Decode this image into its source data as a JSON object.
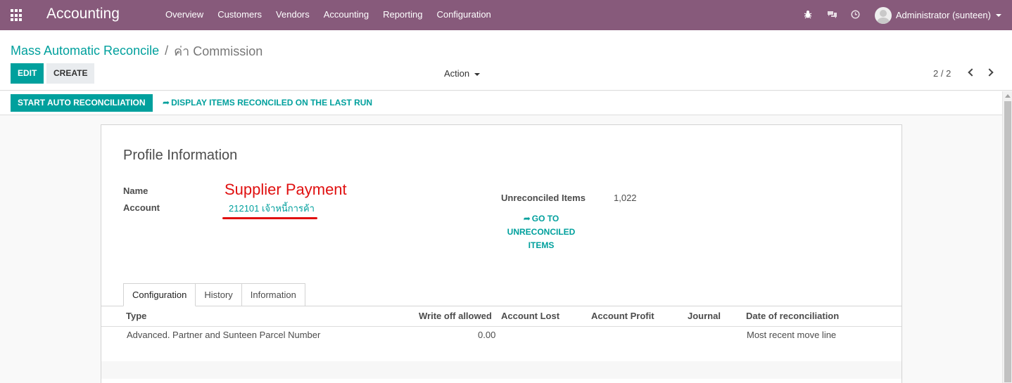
{
  "navbar": {
    "brand": "Accounting",
    "menu": [
      "Overview",
      "Customers",
      "Vendors",
      "Accounting",
      "Reporting",
      "Configuration"
    ],
    "user": "Administrator (sunteen)",
    "icons": [
      "apps-grid-icon",
      "bug-icon",
      "chat-icon",
      "clock-icon"
    ]
  },
  "breadcrumb": {
    "parent": "Mass Automatic Reconcile",
    "separator": "/",
    "current": "ค่า Commission"
  },
  "buttons": {
    "edit": "EDIT",
    "create": "CREATE",
    "action": "Action"
  },
  "pager": {
    "value": "2 / 2"
  },
  "statusbar": {
    "start": "START AUTO RECONCILIATION",
    "display_link": "DISPLAY ITEMS RECONCILED ON THE LAST RUN"
  },
  "sheet": {
    "title": "Profile Information",
    "name_label": "Name",
    "name_value": "Supplier Payment",
    "account_label": "Account",
    "account_value": "212101 เจ้าหนี้การค้า",
    "unreconciled_label": "Unreconciled Items",
    "unreconciled_value": "1,022",
    "go_to_line1": "GO TO",
    "go_to_line2": "UNRECONCILED",
    "go_to_line3": "ITEMS"
  },
  "tabs": [
    "Configuration",
    "History",
    "Information"
  ],
  "table": {
    "headers": [
      "Type",
      "Write off allowed",
      "Account Lost",
      "Account Profit",
      "Journal",
      "Date of reconciliation"
    ],
    "rows": [
      {
        "type": "Advanced. Partner and Sunteen Parcel Number",
        "write_off": "0.00",
        "account_lost": "",
        "account_profit": "",
        "journal": "",
        "date": "Most recent move line"
      }
    ]
  },
  "colors": {
    "navbar": "#875a7b",
    "primary": "#00a09d",
    "annotation": "#e01010"
  }
}
